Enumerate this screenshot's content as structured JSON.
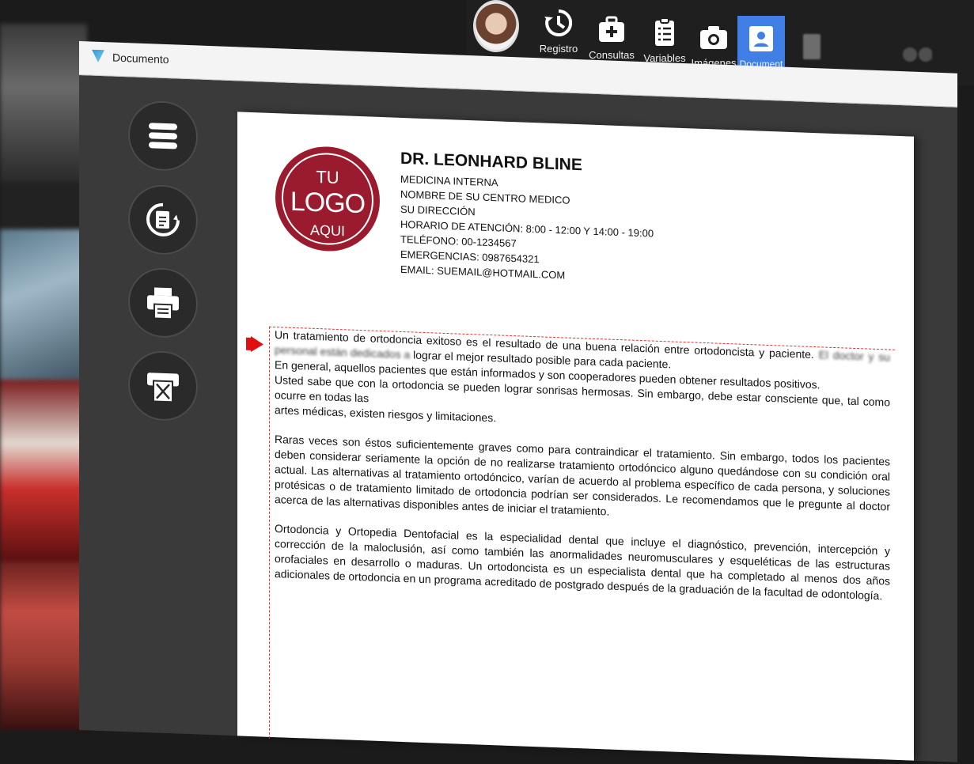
{
  "nav": {
    "items": [
      {
        "label": "Registro",
        "icon": "history-icon"
      },
      {
        "label": "Consultas",
        "icon": "medical-bag-icon"
      },
      {
        "label": "Variables",
        "icon": "clipboard-list-icon"
      },
      {
        "label": "Imágenes",
        "icon": "camera-icon"
      },
      {
        "label": "Document",
        "icon": "document-user-icon"
      }
    ]
  },
  "window": {
    "title": "Documento"
  },
  "sidebar": {
    "buttons": [
      {
        "name": "menu-button",
        "icon": "menu-icon"
      },
      {
        "name": "reload-document-button",
        "icon": "document-refresh-icon"
      },
      {
        "name": "print-button",
        "icon": "printer-icon"
      },
      {
        "name": "print-cancel-button",
        "icon": "printer-cancel-icon"
      }
    ]
  },
  "document": {
    "logo": {
      "line1": "TU",
      "line2": "LOGO",
      "line3": "AQUI"
    },
    "doctor": "DR. LEONHARD BLINE",
    "header_lines": [
      "MEDICINA INTERNA",
      "NOMBRE DE SU CENTRO MEDICO",
      "SU DIRECCIÓN",
      "HORARIO DE ATENCIÓN: 8:00 - 12:00 Y 14:00 - 19:00",
      "TELÉFONO: 00-1234567",
      "EMERGENCIAS: 0987654321",
      "EMAIL: SUEMAIL@HOTMAIL.COM"
    ],
    "paragraphs": [
      {
        "text": "Un tratamiento de ortodoncia exitoso es el resultado de una buena relación entre ortodoncista y paciente.",
        "tail": "El doctor y su personal están dedicados a",
        "rest": "lograr el mejor resultado posible para cada paciente.\nEn general, aquellos pacientes que están informados y son cooperadores pueden obtener resultados positivos.\nUsted sabe que con la ortodoncia se pueden lograr sonrisas hermosas. Sin embargo, debe estar consciente que, tal como ocurre en todas las\nartes médicas, existen riesgos y limitaciones."
      },
      {
        "text": "Raras veces son éstos suficientemente graves como para contraindicar el tratamiento. Sin embargo, todos los pacientes deben considerar seriamente la opción de no realizarse tratamiento ortodóncico alguno quedándose con su condición oral actual. Las alternativas al tratamiento ortodóncico, varían de acuerdo al problema específico de cada persona, y soluciones protésicas o de tratamiento limitado de ortodoncia podrían ser considerados. Le recomendamos que le pregunte al doctor acerca de las alternativas disponibles antes de iniciar el tratamiento.",
        "tail": "",
        "rest": ""
      },
      {
        "text": "Ortodoncia y Ortopedia Dentofacial es la especialidad dental que incluye el diagnóstico, prevención, intercepción y corrección de la maloclusión, así como también las anormalidades neuromusculares y esqueléticas de las estructuras orofaciales en desarrollo o maduras. Un ortodoncista es un especialista dental que ha completado al menos dos años adicionales de ortodoncia en un programa acreditado de postgrado después de la graduación de la facultad de odontología.",
        "tail": "",
        "rest": ""
      }
    ]
  }
}
